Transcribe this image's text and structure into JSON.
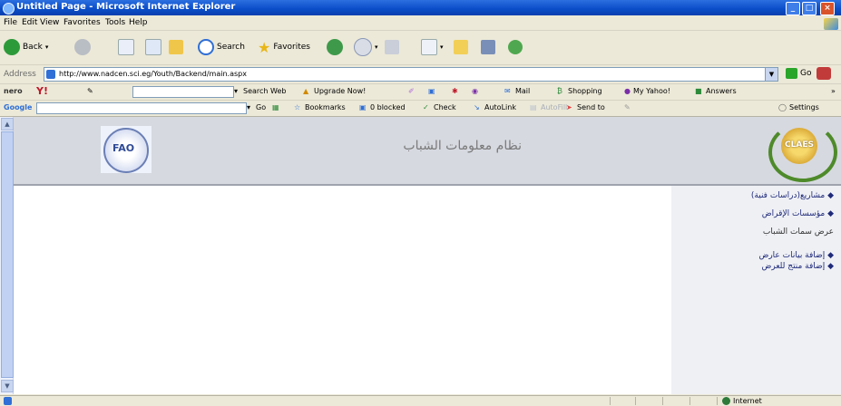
{
  "window": {
    "title": "Untitled Page - Microsoft Internet Explorer",
    "min": "_",
    "max": "□",
    "close": "×"
  },
  "menu": [
    "File",
    "Edit",
    "View",
    "Favorites",
    "Tools",
    "Help"
  ],
  "toolbar": {
    "back": "Back",
    "search": "Search",
    "favorites": "Favorites"
  },
  "address": {
    "label": "Address",
    "url": "http://www.nadcen.sci.eg/Youth/Backend/main.aspx",
    "go": "Go"
  },
  "yahoo_bar": {
    "search_web": "Search Web",
    "upgrade": "Upgrade Now!",
    "mail": "Mail",
    "shopping": "Shopping",
    "my_yahoo": "My Yahoo!",
    "answers": "Answers"
  },
  "google_bar": {
    "brand": "Google",
    "go": "Go",
    "bookmarks": "Bookmarks",
    "blocked": "0 blocked",
    "check": "Check",
    "autolink": "AutoLink",
    "autofill": "AutoFill",
    "sendto": "Send to",
    "settings": "Settings"
  },
  "banner": {
    "title": "نظام معلومات الشباب",
    "fao_logo_text": "FAO",
    "crest_text": "CLAES"
  },
  "sidebar": {
    "items": [
      "مشاريع(دراسات فنية)",
      "مؤسسات الإقراض",
      "عرض سمات الشباب",
      "إضافة بيانات عارض",
      "إضافة منتج للعرض"
    ]
  },
  "status": {
    "zone": "Internet"
  }
}
